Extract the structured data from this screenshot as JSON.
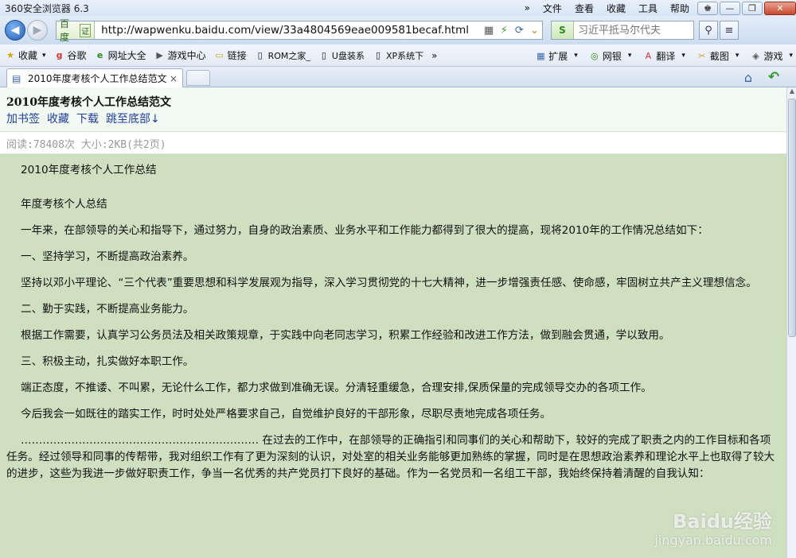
{
  "window": {
    "app_title": "360安全浏览器 6.3",
    "menu": [
      "文件",
      "查看",
      "收藏",
      "工具",
      "帮助"
    ],
    "title_arrows": "»"
  },
  "address_bar": {
    "engine_label": "百度",
    "engine_badge": "证",
    "url": "http://wapwenku.baidu.com/view/33a4804569eae009581becaf.html",
    "search_placeholder": "习近平抵马尔代夫"
  },
  "favorites": {
    "items": [
      {
        "label": "收藏",
        "icon": "★"
      },
      {
        "label": "谷歌",
        "icon": "g"
      },
      {
        "label": "网址大全",
        "icon": "e"
      },
      {
        "label": "游戏中心",
        "icon": "▶"
      },
      {
        "label": "链接",
        "icon": "▭"
      },
      {
        "label": "ROM之家_",
        "icon": "▯"
      },
      {
        "label": "U盘装系",
        "icon": "▯"
      },
      {
        "label": "XP系统下",
        "icon": "▯"
      }
    ],
    "overflow": "»",
    "tools": [
      {
        "label": "扩展",
        "icon": "▦"
      },
      {
        "label": "网银",
        "icon": "◎"
      },
      {
        "label": "翻译",
        "icon": "A"
      },
      {
        "label": "截图",
        "icon": "✂"
      },
      {
        "label": "游戏",
        "icon": "◈"
      }
    ]
  },
  "tabs": {
    "active_title": "2010年度考核个人工作总结范文",
    "close_glyph": "×"
  },
  "document": {
    "title": "2010年度考核个人工作总结范文",
    "links": [
      "加书签",
      "收藏",
      "下载",
      "跳至底部↓"
    ],
    "meta": "阅读:78408次 大小:2KB(共2页)",
    "body_title": "2010年度考核个人工作总结",
    "paragraphs": [
      "年度考核个人总结",
      "一年来，在部领导的关心和指导下，通过努力，自身的政治素质、业务水平和工作能力都得到了很大的提高，现将2010年的工作情况总结如下：",
      "一、坚持学习，不断提高政治素养。",
      "坚持以邓小平理论、“三个代表”重要思想和科学发展观为指导，深入学习贯彻党的十七大精神，进一步增强责任感、使命感，牢固树立共产主义理想信念。",
      "二、勤于实践，不断提高业务能力。",
      "根据工作需要，认真学习公务员法及相关政策规章，于实践中向老同志学习，积累工作经验和改进工作方法，做到融会贯通，学以致用。",
      "三、积极主动，扎实做好本职工作。",
      "端正态度，不推诿、不叫累，无论什么工作，都力求做到准确无误。分清轻重缓急，合理安排,保质保量的完成领导交办的各项工作。",
      "今后我会一如既往的踏实工作，时时处处严格要求自己，自觉维护良好的干部形象，尽职尽责地完成各项任务。",
      "………………………………………………………… 在过去的工作中，在部领导的正确指引和同事们的关心和帮助下，较好的完成了职责之内的工作目标和各项任务。经过领导和同事的传帮带，我对组织工作有了更为深刻的认识，对处室的相关业务能够更加熟练的掌握，同时是在思想政治素养和理论水平上也取得了较大的进步，这些为我进一步做好职责工作，争当一名优秀的共产党员打下良好的基础。作为一名党员和一名组工干部，我始终保持着清醒的自我认知："
    ]
  },
  "watermark": {
    "main": "Baidu经验",
    "sub": "jingyan.baidu.com"
  }
}
